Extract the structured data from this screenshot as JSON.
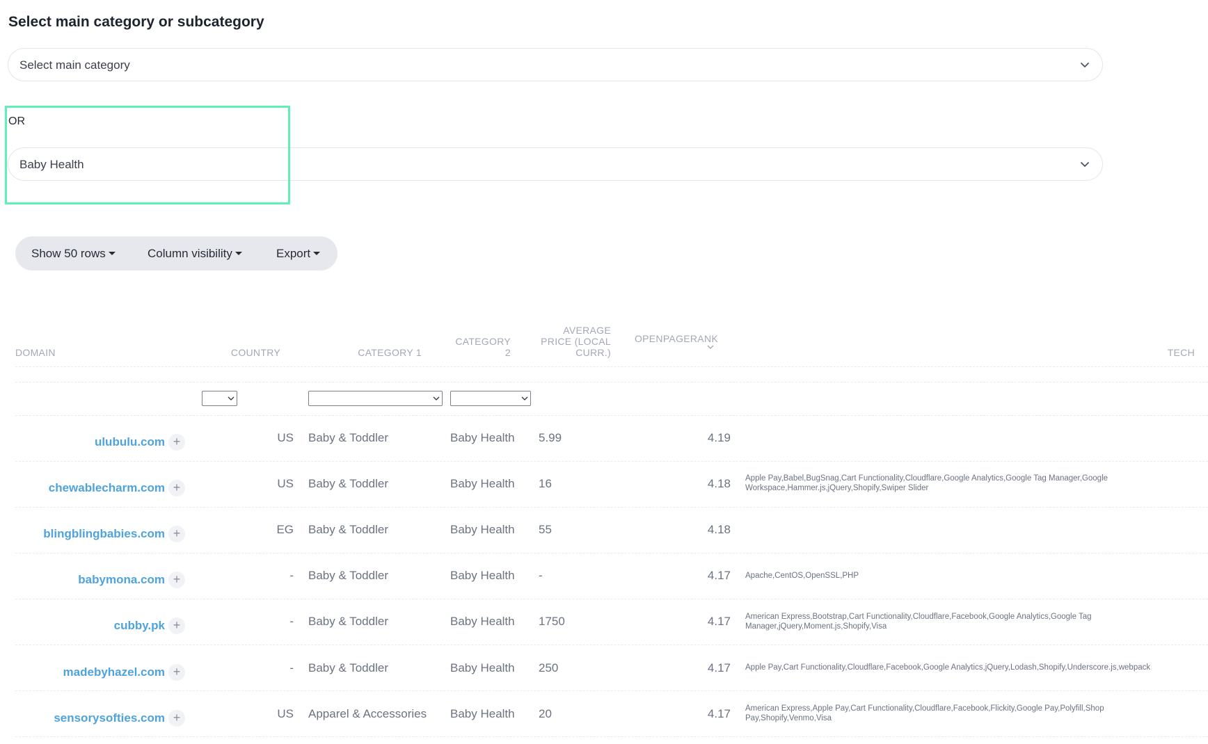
{
  "heading": "Select main category or subcategory",
  "main_select": {
    "value": "Select main category"
  },
  "or_label": "OR",
  "sub_select": {
    "value": "Baby Health"
  },
  "toolbar": {
    "show_rows": "Show 50 rows",
    "column_visibility": "Column visibility",
    "export": "Export"
  },
  "columns": {
    "domain": "DOMAIN",
    "country": "COUNTRY",
    "category1": "CATEGORY 1",
    "category2_l1": "CATEGORY",
    "category2_l2": "2",
    "avgprice_l1": "AVERAGE",
    "avgprice_l2": "PRICE (LOCAL",
    "avgprice_l3": "CURR.)",
    "openpagerank": "OPENPAGERANK",
    "tech": "TECH"
  },
  "rows": [
    {
      "domain": "ulubulu.com",
      "country": "US",
      "cat1": "Baby & Toddler",
      "cat2": "Baby Health",
      "price": "5.99",
      "opr": "4.19",
      "tech1": "",
      "tech2": ""
    },
    {
      "domain": "chewablecharm.com",
      "country": "US",
      "cat1": "Baby & Toddler",
      "cat2": "Baby Health",
      "price": "16",
      "opr": "4.18",
      "tech1": "Apple Pay,Babel,BugSnag,Cart Functionality,Cloudflare,Google Analytics,Google Tag Manager,Google",
      "tech2": "Workspace,Hammer.js,jQuery,Shopify,Swiper Slider"
    },
    {
      "domain": "blingblingbabies.com",
      "country": "EG",
      "cat1": "Baby & Toddler",
      "cat2": "Baby Health",
      "price": "55",
      "opr": "4.18",
      "tech1": "",
      "tech2": ""
    },
    {
      "domain": "babymona.com",
      "country": "-",
      "cat1": "Baby & Toddler",
      "cat2": "Baby Health",
      "price": "-",
      "opr": "4.17",
      "tech1": "Apache,CentOS,OpenSSL,PHP",
      "tech2": ""
    },
    {
      "domain": "cubby.pk",
      "country": "-",
      "cat1": "Baby & Toddler",
      "cat2": "Baby Health",
      "price": "1750",
      "opr": "4.17",
      "tech1": "American Express,Bootstrap,Cart Functionality,Cloudflare,Facebook,Google Analytics,Google Tag",
      "tech2": "Manager,jQuery,Moment.js,Shopify,Visa"
    },
    {
      "domain": "madebyhazel.com",
      "country": "-",
      "cat1": "Baby & Toddler",
      "cat2": "Baby Health",
      "price": "250",
      "opr": "4.17",
      "tech1": "Apple Pay,Cart Functionality,Cloudflare,Facebook,Google Analytics,jQuery,Lodash,Shopify,Underscore.js,webpack",
      "tech2": ""
    },
    {
      "domain": "sensorysofties.com",
      "country": "US",
      "cat1": "Apparel & Accessories",
      "cat2": "Baby Health",
      "price": "20",
      "opr": "4.17",
      "tech1": "American Express,Apple Pay,Cart Functionality,Cloudflare,Facebook,Flickity,Google Pay,Polyfill,Shop",
      "tech2": "Pay,Shopify,Venmo,Visa"
    }
  ]
}
